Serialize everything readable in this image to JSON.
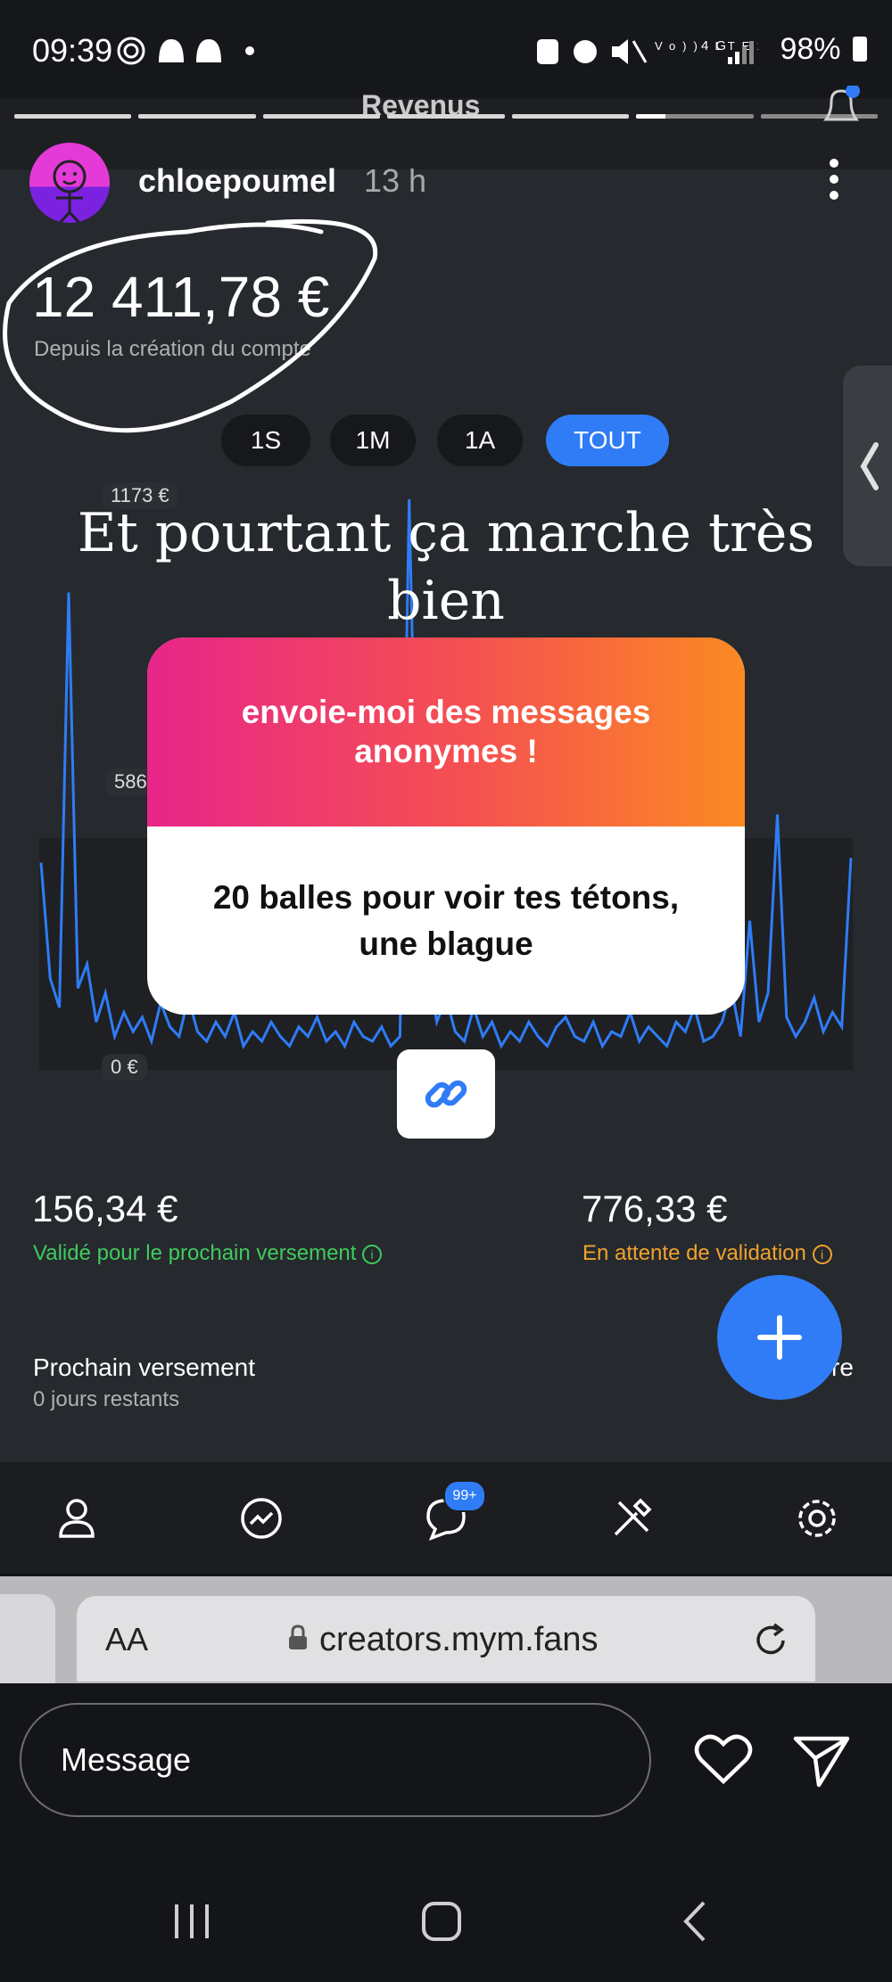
{
  "status_bar": {
    "time": "09:39",
    "network_lte": "Vo)) LTE1",
    "network_4g": "4G",
    "battery": "98%"
  },
  "story": {
    "tab_title": "Revenus",
    "username": "chloepoumel",
    "time_ago": "13 h",
    "overlay_text": "Et pourtant ça marche très bien"
  },
  "dashboard": {
    "balance": "12 411,78 €",
    "balance_caption": "Depuis la création du compte",
    "ranges": [
      "1S",
      "1M",
      "1A",
      "TOUT"
    ],
    "active_range": "TOUT",
    "validated_amount": "156,34 €",
    "validated_caption": "Validé pour le prochain versement",
    "pending_amount": "776,33 €",
    "pending_caption": "En attente de validation",
    "next_payout_title": "Prochain versement",
    "next_payout_sub": "0 jours restants",
    "partial_right_text": "re",
    "colors": {
      "accent": "#2f7cf6",
      "green": "#3fcb5d",
      "orange": "#f0a22c"
    }
  },
  "chart_data": {
    "type": "line",
    "y_ticks": [
      "1173 €",
      "586",
      "0 €"
    ],
    "ylim": [
      0,
      1173
    ],
    "values": [
      420,
      180,
      120,
      980,
      160,
      210,
      90,
      150,
      60,
      110,
      70,
      100,
      50,
      130,
      80,
      60,
      140,
      70,
      50,
      90,
      60,
      110,
      40,
      70,
      50,
      90,
      60,
      40,
      80,
      60,
      100,
      50,
      70,
      40,
      90,
      60,
      50,
      80,
      40,
      60,
      1173,
      320,
      200,
      90,
      140,
      70,
      50,
      120,
      60,
      90,
      40,
      70,
      50,
      90,
      60,
      40,
      80,
      100,
      60,
      50,
      90,
      40,
      70,
      60,
      110,
      50,
      80,
      60,
      40,
      90,
      70,
      120,
      50,
      60,
      90,
      160,
      60,
      300,
      90,
      150,
      520,
      100,
      60,
      90,
      140,
      70,
      110,
      80,
      430
    ]
  },
  "question_sticker": {
    "prompt": "envoie-moi des messages anonymes !",
    "answer": "20 balles pour voir tes tétons, une blague"
  },
  "bottom_nav": {
    "badge": "99+",
    "icons": [
      "profile-icon",
      "stats-icon",
      "chat-icon",
      "tools-icon",
      "settings-icon"
    ]
  },
  "browser": {
    "aa_label": "AA",
    "url": "creators.mym.fans"
  },
  "reply": {
    "message_placeholder": "Message"
  }
}
